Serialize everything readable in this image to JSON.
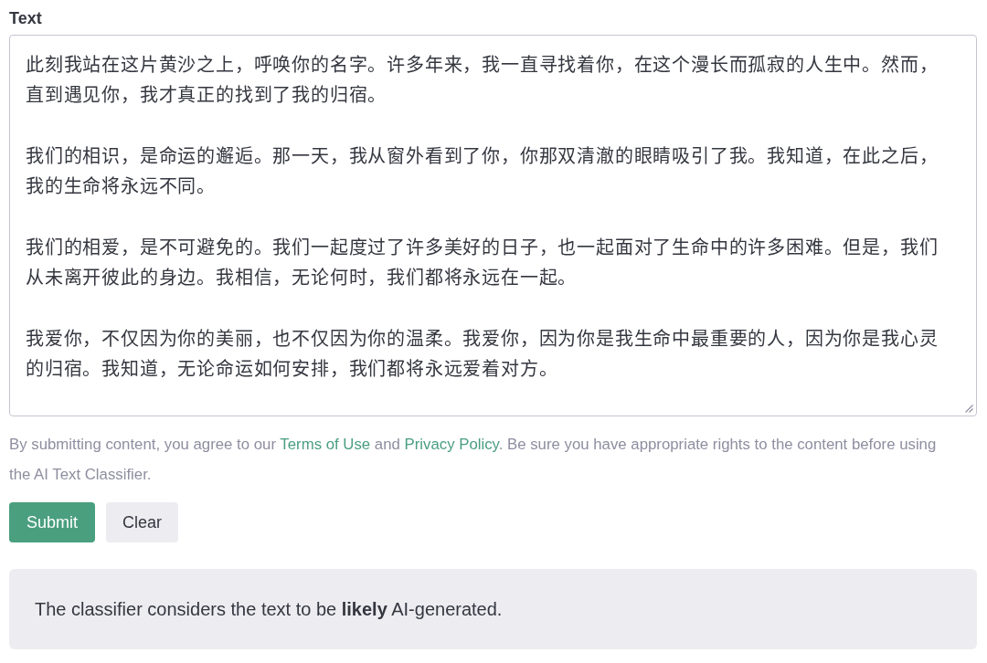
{
  "text_field": {
    "label": "Text",
    "paragraphs": [
      "此刻我站在这片黄沙之上，呼唤你的名字。许多年来，我一直寻找着你，在这个漫长而孤寂的人生中。然而，直到遇见你，我才真正的找到了我的归宿。",
      "我们的相识，是命运的邂逅。那一天，我从窗外看到了你，你那双清澈的眼睛吸引了我。我知道，在此之后，我的生命将永远不同。",
      "我们的相爱，是不可避免的。我们一起度过了许多美好的日子，也一起面对了生命中的许多困难。但是，我们从未离开彼此的身边。我相信，无论何时，我们都将永远在一起。",
      "我爱你，不仅因为你的美丽，也不仅因为你的温柔。我爱你，因为你是我生命中最重要的人，因为你是我心灵的归宿。我知道，无论命运如何安排，我们都将永远爱着对方。"
    ]
  },
  "disclaimer": [
    {
      "kind": "text",
      "text": "By submitting content, you agree to our "
    },
    {
      "kind": "link",
      "text": "Terms of Use"
    },
    {
      "kind": "text",
      "text": " and "
    },
    {
      "kind": "link",
      "text": "Privacy Policy"
    },
    {
      "kind": "text",
      "text": ". Be sure you have appropriate rights to the content before using the AI Text Classifier."
    }
  ],
  "buttons": [
    {
      "label": "Submit",
      "kind": "primary"
    },
    {
      "label": "Clear",
      "kind": "secondary"
    }
  ],
  "result": {
    "text": "The classifier considers the text to be **likely** AI-generated."
  }
}
